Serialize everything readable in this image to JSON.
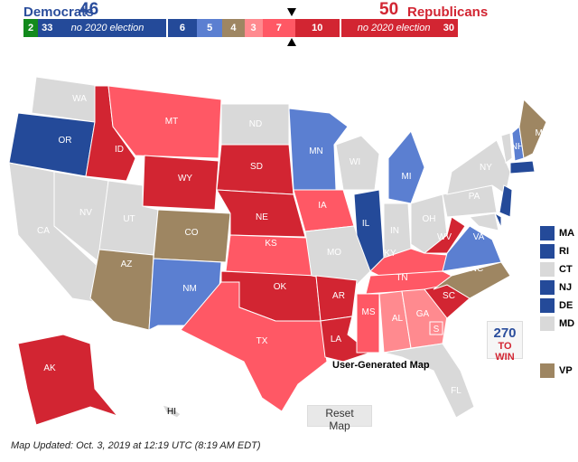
{
  "header": {
    "dem_label": "Democrats",
    "dem_count": "46",
    "rep_count": "50",
    "rep_label": "Republicans"
  },
  "colors": {
    "green": "#128a1c",
    "safe_d": "#244a99",
    "likely_d": "#5b7fd1",
    "tossup": "#9e8662",
    "lean_r": "#ff8a8f",
    "likely_r": "#ff5865",
    "safe_r": "#d22532",
    "none": "#d9d9d9"
  },
  "bar": [
    {
      "text": "2",
      "color": "#128a1c",
      "flex": 2
    },
    {
      "text": "33",
      "note": "no 2020 election",
      "color": "#244a99",
      "flex": 33
    },
    {
      "text": "6",
      "color": "#244a99",
      "flex": 6
    },
    {
      "text": "5",
      "color": "#5b7fd1",
      "flex": 5
    },
    {
      "text": "4",
      "color": "#9e8662",
      "flex": 4
    },
    {
      "text": "3",
      "color": "#ff8a8f",
      "flex": 3
    },
    {
      "text": "7",
      "color": "#ff5865",
      "flex": 7
    },
    {
      "text": "10",
      "color": "#d22532",
      "flex": 10
    },
    {
      "note": "no 2020 election",
      "text": "30",
      "color": "#d22532",
      "flex": 30
    }
  ],
  "states": {
    "WA": "none",
    "OR": "safe_d",
    "CA": "none",
    "NV": "none",
    "ID": "safe_r",
    "MT": "likely_r",
    "WY": "safe_r",
    "UT": "none",
    "AZ": "tossup",
    "CO": "tossup",
    "NM": "likely_d",
    "ND": "none",
    "SD": "safe_r",
    "NE": "safe_r",
    "KS": "likely_r",
    "OK": "safe_r",
    "TX": "likely_r",
    "MN": "likely_d",
    "IA": "likely_r",
    "MO": "none",
    "AR": "safe_r",
    "LA": "safe_r",
    "WI": "none",
    "IL": "safe_d",
    "MI": "likely_d",
    "IN": "none",
    "OH": "none",
    "KY": "likely_r",
    "TN": "likely_r",
    "MS": "likely_r",
    "AL": "lean_r",
    "GA": "lean_r",
    "FL": "none",
    "SC": "safe_r",
    "NC": "tossup",
    "VA": "likely_d",
    "WV": "safe_r",
    "PA": "none",
    "NY": "none",
    "VT": "none",
    "NH": "likely_d",
    "ME": "tossup",
    "MA": "safe_d",
    "NJ": "safe_d",
    "DE": "safe_d",
    "MD": "none",
    "AK": "safe_r",
    "HI": "none"
  },
  "georgia_special": "S",
  "legend": [
    {
      "label": "MA",
      "rating": "safe_d"
    },
    {
      "label": "RI",
      "rating": "safe_d"
    },
    {
      "label": "CT",
      "rating": "none"
    },
    {
      "label": "NJ",
      "rating": "safe_d"
    },
    {
      "label": "DE",
      "rating": "safe_d"
    },
    {
      "label": "MD",
      "rating": "none"
    },
    {
      "label": "VP",
      "rating": "tossup"
    }
  ],
  "logo": {
    "line1": "270",
    "line2": "TO WIN"
  },
  "map_caption": "User-Generated Map",
  "reset_label": "Reset Map",
  "updated": "Map Updated: Oct. 3, 2019 at 12:19 UTC (8:19 AM EDT)"
}
